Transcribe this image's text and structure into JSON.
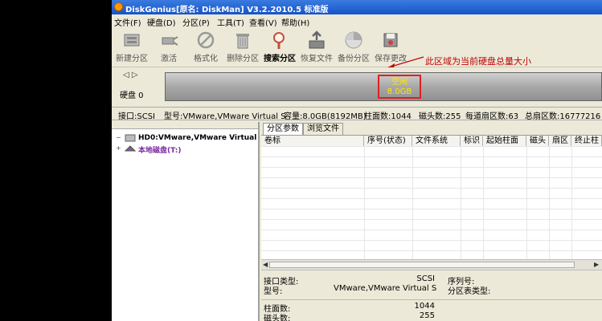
{
  "window": {
    "title": "DiskGenius[原名: DiskMan] V3.2.2010.5 标准版"
  },
  "menu": [
    "文件(F)",
    "硬盘(D)",
    "分区(P)",
    "工具(T)",
    "查看(V)",
    "帮助(H)"
  ],
  "toolbar": {
    "new_partition": "新建分区",
    "activate": "激活",
    "format": "格式化",
    "delete_partition": "删除分区",
    "search_partition": "搜索分区",
    "recover_files": "恢复文件",
    "backup_partition": "备份分区",
    "save_changes": "保存更改"
  },
  "annotation": {
    "text": "此区域为当前硬盘总量大小",
    "color": "#c00000"
  },
  "disk_bar": {
    "nav": "◁ ▷",
    "disk_label": "硬盘 0",
    "free_label": "空闲",
    "free_size": "8.0GB"
  },
  "disk_info": {
    "interface": "接口:SCSI",
    "model": "型号:VMware,VMware Virtual S",
    "capacity": "容量:8.0GB(8192MB)",
    "cylinders": "柱面数:1044",
    "heads": "磁头数:255",
    "sectors_per_track": "每道扇区数:63",
    "total_sectors": "总扇区数:16777216"
  },
  "tree": {
    "disk": "HD0:VMware,VMware Virtual",
    "local": "本地磁盘(T:)"
  },
  "tabs": [
    "分区参数",
    "浏览文件"
  ],
  "partition_table": {
    "columns": [
      "卷标",
      "序号(状态)",
      "文件系统",
      "标识",
      "起始柱面",
      "磁头",
      "扇区",
      "终止柱"
    ]
  },
  "details": {
    "interface_type_label": "接口类型:",
    "interface_type_value": "SCSI",
    "serial_label": "序列号:",
    "model_label": "型号:",
    "model_value": "VMware,VMware Virtual S",
    "partition_table_type_label": "分区表类型:",
    "cylinders_label": "柱面数:",
    "cylinders_value": "1044",
    "heads_label": "磁头数:",
    "heads_value": "255"
  },
  "colors": {
    "title_bar": "#1653c8",
    "window_bg": "#ece9d8",
    "free_highlight": "#e02020",
    "free_text": "#ffe600"
  }
}
